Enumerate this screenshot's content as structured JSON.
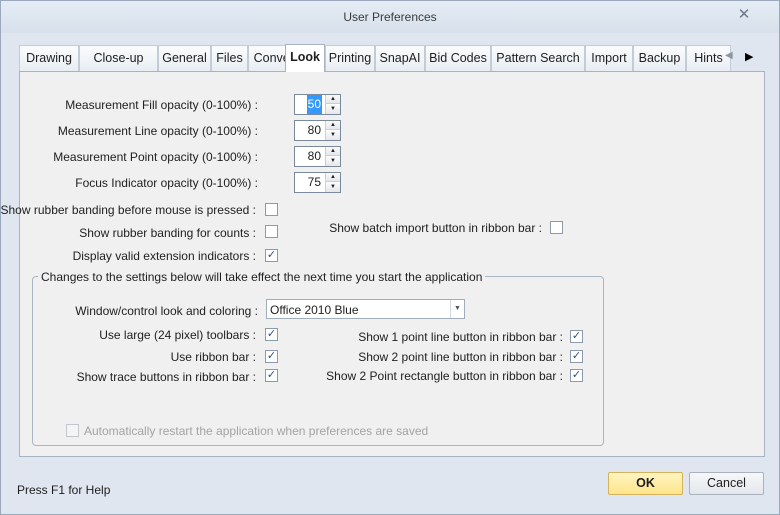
{
  "window": {
    "title": "User Preferences"
  },
  "tabs": [
    {
      "label": "Drawing"
    },
    {
      "label": "Close-up"
    },
    {
      "label": "General"
    },
    {
      "label": "Files"
    },
    {
      "label": "Convert"
    },
    {
      "label": "Look",
      "active": true
    },
    {
      "label": "Printing"
    },
    {
      "label": "SnapAI"
    },
    {
      "label": "Bid Codes"
    },
    {
      "label": "Pattern Search"
    },
    {
      "label": "Import"
    },
    {
      "label": "Backup"
    },
    {
      "label": "Hints"
    }
  ],
  "opacity": {
    "fill": {
      "label": "Measurement Fill opacity (0-100%) :",
      "value": "50"
    },
    "line": {
      "label": "Measurement Line opacity (0-100%) :",
      "value": "80"
    },
    "point": {
      "label": "Measurement Point opacity (0-100%) :",
      "value": "80"
    },
    "focus": {
      "label": "Focus Indicator opacity (0-100%) :",
      "value": "75"
    }
  },
  "options": {
    "rubber_band_before": {
      "label": "Show rubber banding before mouse is pressed :",
      "checked": false
    },
    "rubber_band_counts": {
      "label": "Show rubber banding for counts :",
      "checked": false
    },
    "valid_extension": {
      "label": "Display valid extension indicators :",
      "checked": true
    },
    "batch_import": {
      "label": "Show batch import button in ribbon bar :",
      "checked": false
    }
  },
  "restart_group": {
    "title": "Changes to the settings below will take effect the next time you start the application",
    "look_label": "Window/control look and coloring :",
    "look_value": "Office 2010 Blue",
    "large_toolbars": {
      "label": "Use large (24 pixel) toolbars :",
      "checked": true
    },
    "ribbon_bar": {
      "label": "Use ribbon bar :",
      "checked": true
    },
    "trace_buttons": {
      "label": "Show trace buttons in ribbon bar :",
      "checked": true
    },
    "one_point_line": {
      "label": "Show 1 point line button in ribbon bar :",
      "checked": true
    },
    "two_point_line": {
      "label": "Show 2 point line button in ribbon bar :",
      "checked": true
    },
    "two_point_rect": {
      "label": "Show 2 Point rectangle button in ribbon bar :",
      "checked": true
    },
    "auto_restart": {
      "label": "Automatically restart the application when preferences are saved",
      "checked": false,
      "disabled": true
    }
  },
  "footer": {
    "help": "Press F1 for Help",
    "ok_label": "OK",
    "cancel_label": "Cancel"
  },
  "check_glyph": "✓"
}
